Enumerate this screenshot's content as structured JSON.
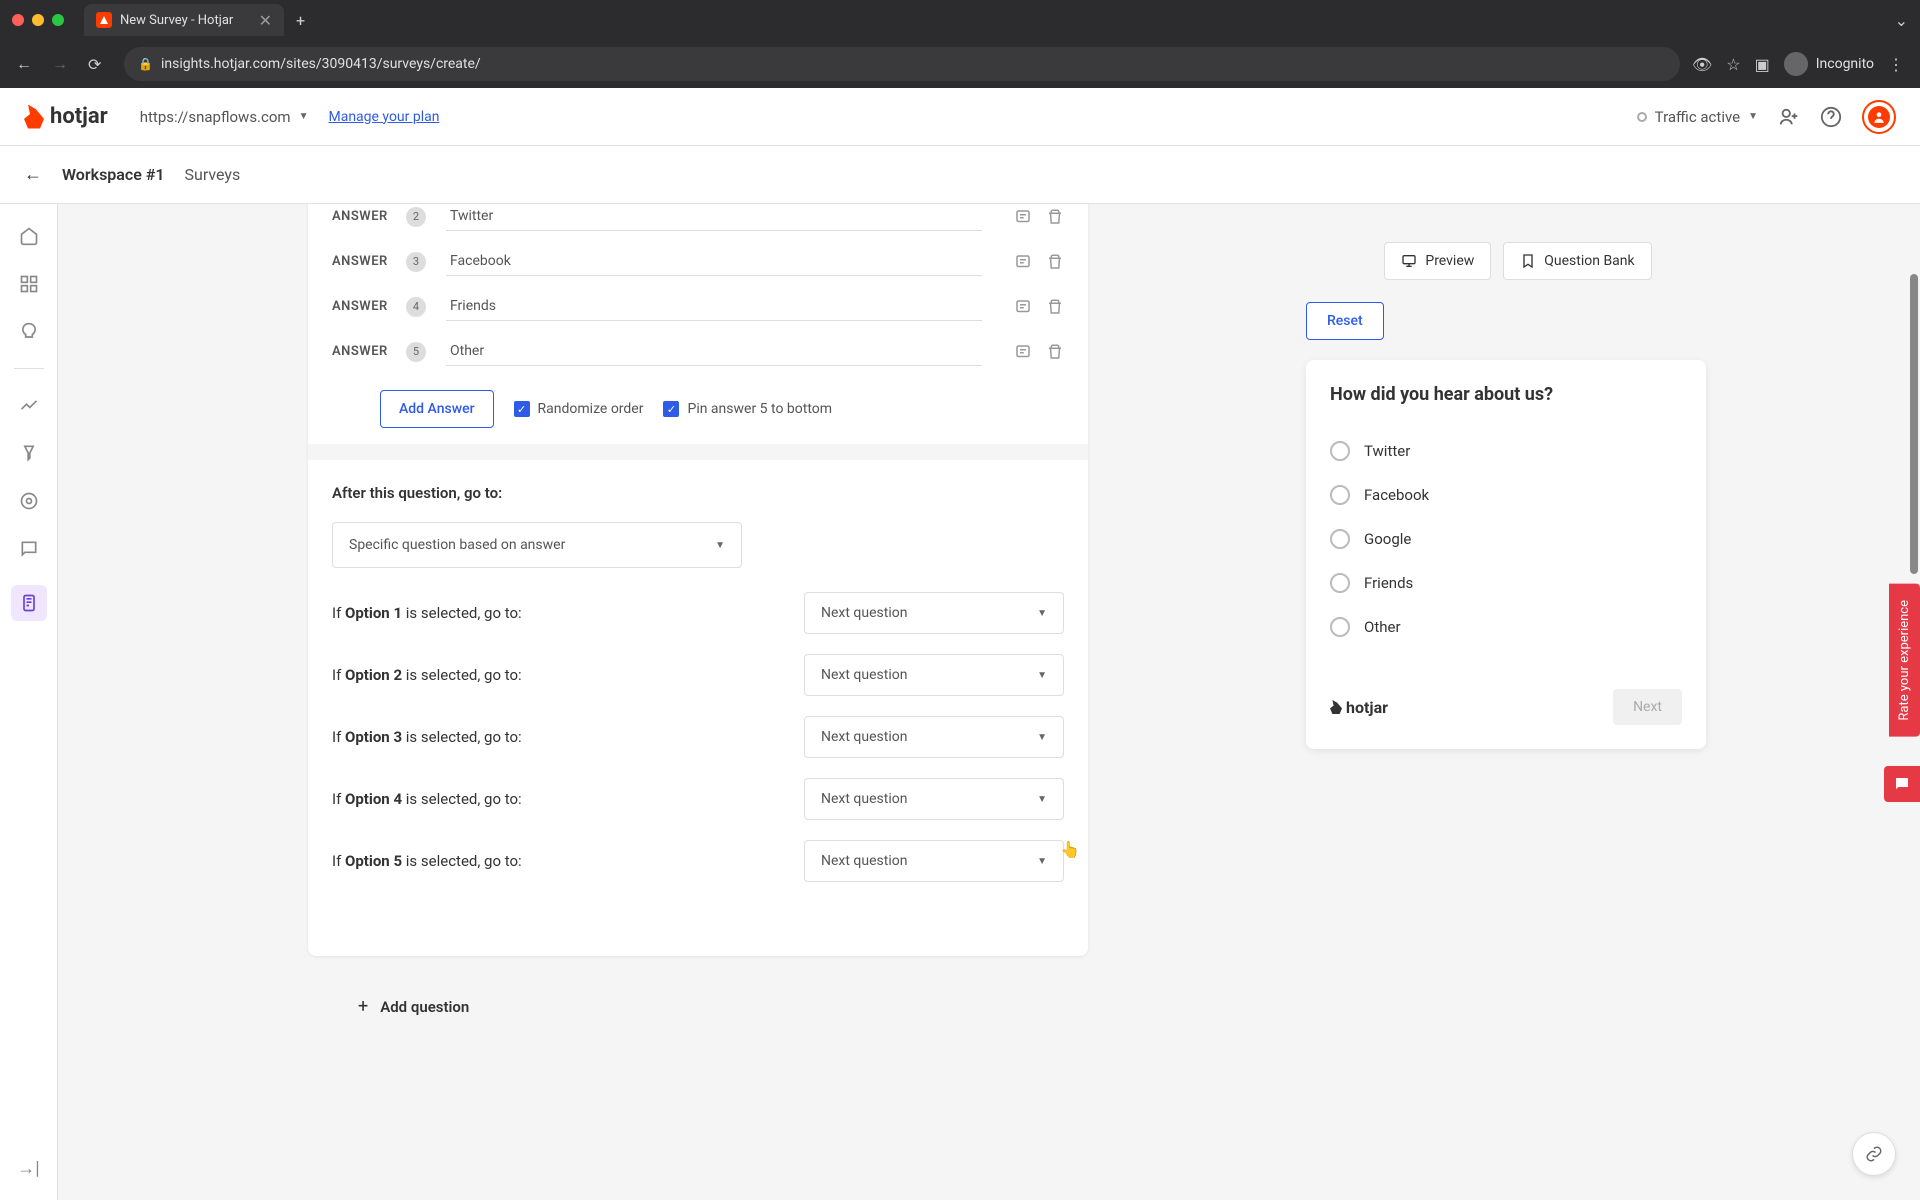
{
  "browser": {
    "tab_title": "New Survey - Hotjar",
    "url": "insights.hotjar.com/sites/3090413/surveys/create/",
    "incognito": "Incognito"
  },
  "header": {
    "logo": "hotjar",
    "site": "https://snapflows.com",
    "manage_plan": "Manage your plan",
    "traffic": "Traffic active"
  },
  "subheader": {
    "workspace": "Workspace #1",
    "section": "Surveys"
  },
  "answers": [
    {
      "num": "2",
      "value": "Twitter"
    },
    {
      "num": "3",
      "value": "Facebook"
    },
    {
      "num": "4",
      "value": "Friends"
    },
    {
      "num": "5",
      "value": "Other"
    }
  ],
  "add_answer": "Add Answer",
  "randomize": "Randomize order",
  "pin": "Pin answer 5 to bottom",
  "logic": {
    "title": "After this question, go to:",
    "main_select": "Specific question based on answer",
    "options": [
      {
        "prefix": "If ",
        "bold": "Option 1",
        "suffix": " is selected, go to:",
        "value": "Next question"
      },
      {
        "prefix": "If ",
        "bold": "Option 2",
        "suffix": " is selected, go to:",
        "value": "Next question"
      },
      {
        "prefix": "If ",
        "bold": "Option 3",
        "suffix": " is selected, go to:",
        "value": "Next question"
      },
      {
        "prefix": "If ",
        "bold": "Option 4",
        "suffix": " is selected, go to:",
        "value": "Next question"
      },
      {
        "prefix": "If ",
        "bold": "Option 5",
        "suffix": " is selected, go to:",
        "value": "Next question"
      }
    ]
  },
  "add_question": "Add question",
  "preview": {
    "preview_btn": "Preview",
    "question_bank_btn": "Question Bank",
    "reset": "Reset",
    "question": "How did you hear about us?",
    "options": [
      "Twitter",
      "Facebook",
      "Google",
      "Friends",
      "Other"
    ],
    "logo": "hotjar",
    "next": "Next"
  },
  "feedback": "Rate your experience",
  "answer_label": "ANSWER"
}
